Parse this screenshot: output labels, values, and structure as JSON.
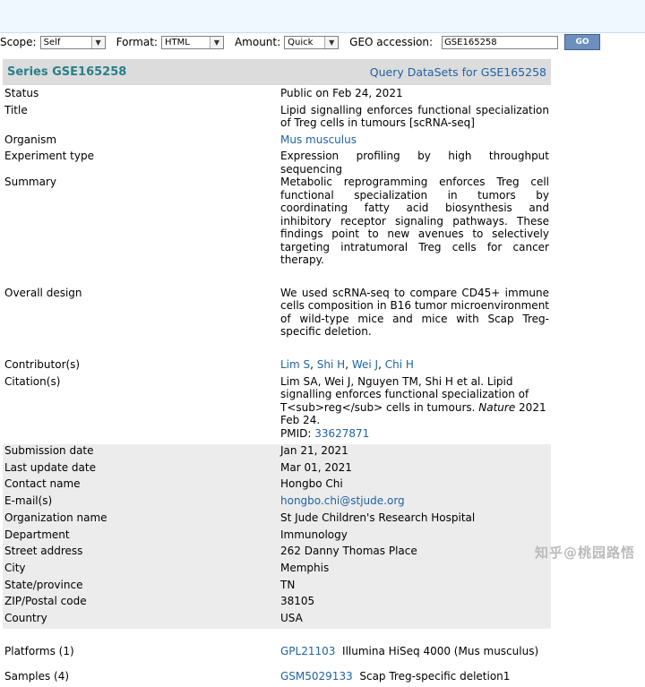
{
  "toolbar": {
    "scope_label": "Scope:",
    "scope_value": "Self",
    "format_label": "Format:",
    "format_value": "HTML",
    "amount_label": "Amount:",
    "amount_value": "Quick",
    "geo_label": "GEO accession:",
    "geo_value": "GSE165258",
    "go_label": "GO"
  },
  "header": {
    "series": "Series GSE165258",
    "query_link": "Query DataSets for GSE165258"
  },
  "fields": {
    "status_k": "Status",
    "status_v": "Public on Feb 24, 2021",
    "title_k": "Title",
    "title_v": "Lipid signalling enforces functional specialization of Treg cells in tumours [scRNA-seq]",
    "organism_k": "Organism",
    "organism_v": "Mus musculus",
    "exptype_k": "Experiment type",
    "exptype_v": "Expression profiling by high throughput sequencing",
    "summary_k": "Summary",
    "summary_v": "Metabolic reprogramming enforces Treg cell functional specialization in tumors by coordinating fatty acid biosynthesis and inhibitory receptor signaling pathways. These findings point to new avenues to selectively targeting intratumoral Treg cells for cancer therapy.",
    "design_k": "Overall design",
    "design_v": "We used scRNA-seq to compare CD45+ immune cells composition in B16 tumor microenvironment of wild-type mice and mice with Scap Treg-specific deletion.",
    "contrib_k": "Contributor(s)",
    "contrib_1": "Lim S",
    "contrib_2": "Shi H",
    "contrib_3": "Wei J",
    "contrib_4": "Chi H",
    "citation_k": "Citation(s)",
    "citation_text": "Lim SA, Wei J, Nguyen TM, Shi H et al. Lipid signalling enforces functional specialization of T<sub>reg</sub> cells in tumours. ",
    "citation_journal": "Nature",
    "citation_date": " 2021 Feb 24.",
    "pmid_label": "PMID: ",
    "pmid_value": "33627871"
  },
  "contact": {
    "subdate_k": "Submission date",
    "subdate_v": "Jan 21, 2021",
    "lastupdate_k": "Last update date",
    "lastupdate_v": "Mar 01, 2021",
    "name_k": "Contact name",
    "name_v": "Hongbo Chi",
    "email_k": "E-mail(s)",
    "email_v": "hongbo.chi@stjude.org",
    "org_k": "Organization name",
    "org_v": "St Jude Children's Research Hospital",
    "dept_k": "Department",
    "dept_v": "Immunology",
    "street_k": "Street address",
    "street_v": "262 Danny Thomas Place",
    "city_k": "City",
    "city_v": "Memphis",
    "state_k": "State/province",
    "state_v": "TN",
    "zip_k": "ZIP/Postal code",
    "zip_v": "38105",
    "country_k": "Country",
    "country_v": "USA"
  },
  "platforms": {
    "label": "Platforms (1)",
    "id": "GPL21103",
    "desc": "Illumina HiSeq 4000 (Mus musculus)"
  },
  "samples": {
    "label": "Samples (4)",
    "id": "GSM5029133",
    "desc": "Scap Treg-specific deletion1"
  },
  "watermark": "知乎 @桃园路悟"
}
